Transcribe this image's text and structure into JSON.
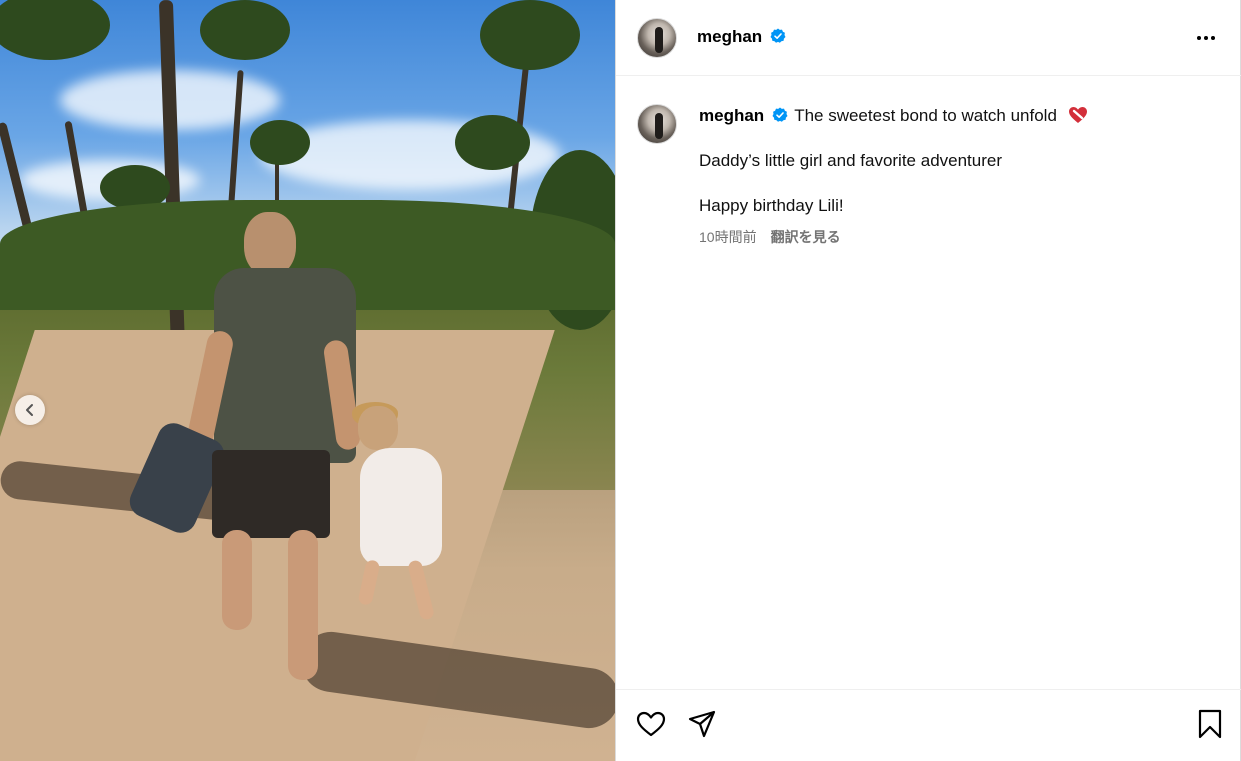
{
  "photo": {
    "alt_semantic": "post-photo",
    "prev_icon": "chevron-left-icon"
  },
  "header": {
    "username": "meghan",
    "verified_icon": "verified-badge-icon",
    "more_icon": "more-horizontal-icon"
  },
  "caption": {
    "username": "meghan",
    "line1": "The sweetest bond to watch unfold",
    "line1_emoji": "❤️‍🩹",
    "line2": "Daddy’s little girl and favorite adventurer",
    "line3": "Happy birthday Lili!",
    "time": "10時間前",
    "translate": "翻訳を見る"
  },
  "actions": {
    "like_icon": "heart-icon",
    "share_icon": "send-icon",
    "save_icon": "bookmark-icon"
  },
  "colors": {
    "verified": "#0095f6",
    "muted": "#737373",
    "border": "#dbdbdb",
    "heart_emoji": "#d32f3a"
  }
}
